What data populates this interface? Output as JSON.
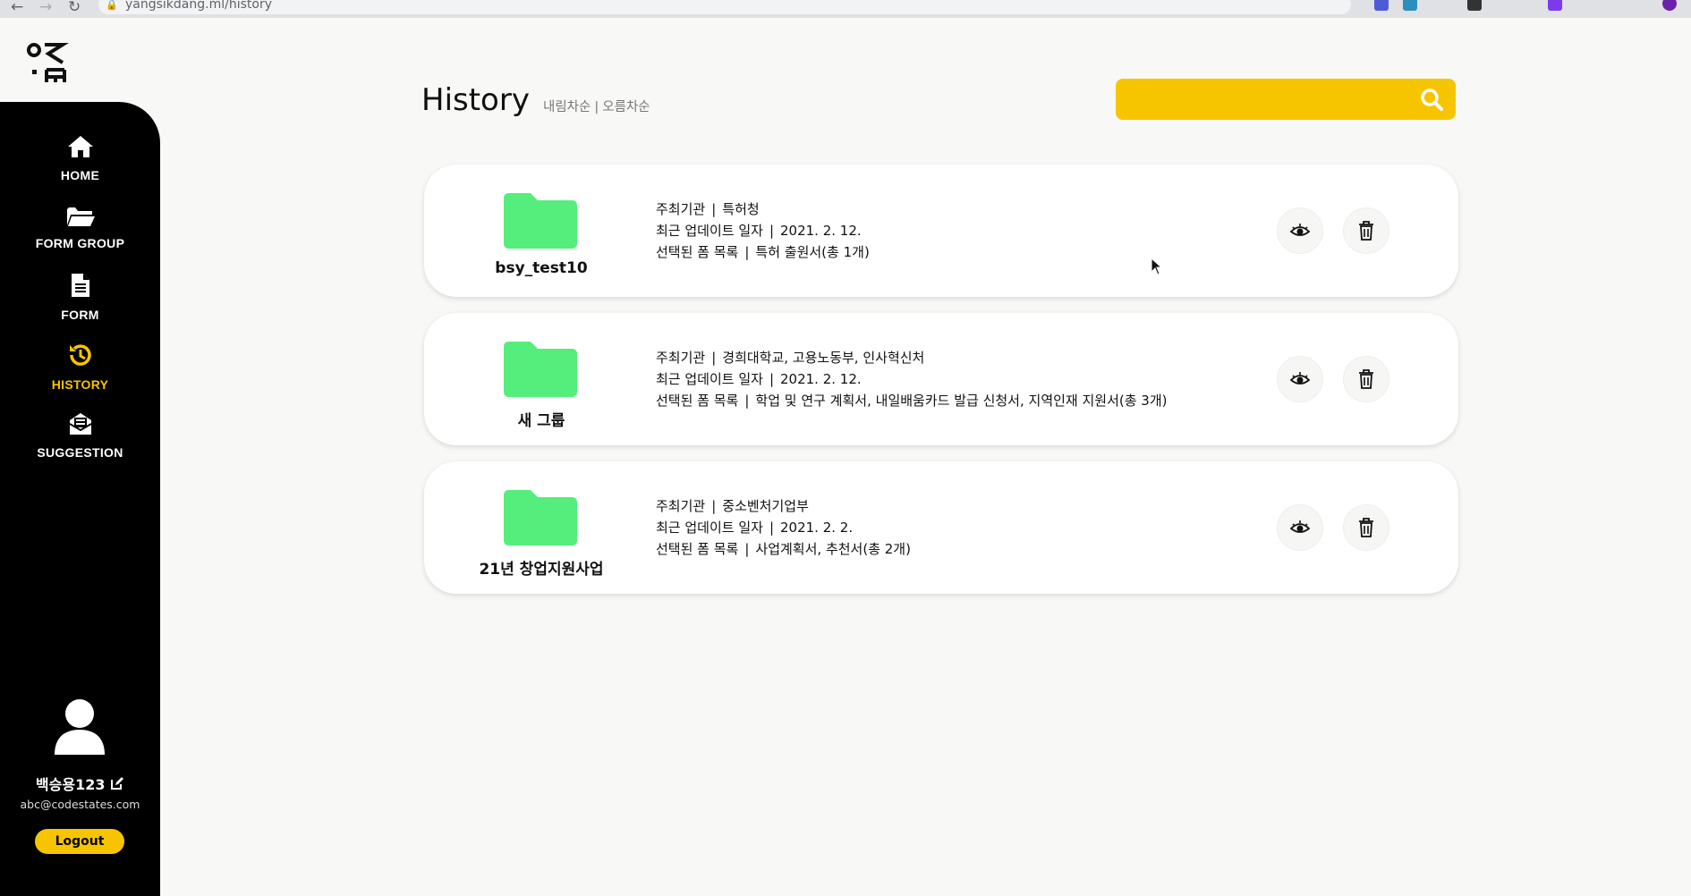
{
  "browser": {
    "url_domain": "yangsikdang.ml",
    "url_path": "/history"
  },
  "sidebar": {
    "items": [
      {
        "label": "HOME",
        "icon": "home-icon"
      },
      {
        "label": "FORM GROUP",
        "icon": "folder-open-icon"
      },
      {
        "label": "FORM",
        "icon": "document-icon"
      },
      {
        "label": "HISTORY",
        "icon": "history-icon",
        "active": true
      },
      {
        "label": "SUGGESTION",
        "icon": "envelope-icon"
      }
    ],
    "user": {
      "name": "백승용123",
      "email": "abc@codestates.com",
      "logout_label": "Logout"
    }
  },
  "header": {
    "title": "History",
    "sort_desc": "내림차순",
    "sort_sep": "|",
    "sort_asc": "오름차순",
    "search_placeholder": ""
  },
  "history": [
    {
      "name": "bsy_test10",
      "org_label": "주최기관",
      "org": "특허청",
      "date_label": "최근 업데이트 일자",
      "date": "2021. 2. 12.",
      "forms_label": "선택된 폼 목록",
      "forms": "특허 출원서(총 1개)"
    },
    {
      "name": "새 그룹",
      "org_label": "주최기관",
      "org": "경희대학교, 고용노동부, 인사혁신처",
      "date_label": "최근 업데이트 일자",
      "date": "2021. 2. 12.",
      "forms_label": "선택된 폼 목록",
      "forms": "학업 및 연구 계획서, 내일배움카드 발급 신청서, 지역인재 지원서(총 3개)"
    },
    {
      "name": "21년 창업지원사업",
      "org_label": "주최기관",
      "org": "중소벤처기업부",
      "date_label": "최근 업데이트 일자",
      "date": "2021. 2. 2.",
      "forms_label": "선택된 폼 목록",
      "forms": "사업계획서, 추천서(총 2개)"
    }
  ],
  "colors": {
    "accent": "#f7c500",
    "sidebar_bg": "#000000",
    "folder": "#55ee7d",
    "page_bg": "#f8f8f6"
  }
}
